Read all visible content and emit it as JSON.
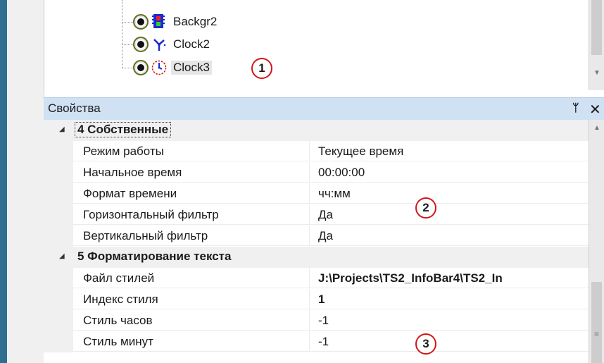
{
  "tree": {
    "nodes": [
      {
        "label": "Backgr2",
        "icon": "film-icon"
      },
      {
        "label": "Clock2",
        "icon": "clock-hands-icon"
      },
      {
        "label": "Clock3",
        "icon": "clock-dial-icon",
        "selected": true
      }
    ]
  },
  "callouts": [
    "1",
    "2",
    "3"
  ],
  "properties": {
    "title": "Свойства",
    "pin_icon": "pin-icon",
    "close_icon": "close-icon",
    "categories": [
      {
        "label": "4 Собственные",
        "rows": [
          {
            "name": "Режим работы",
            "value": "Текущее время"
          },
          {
            "name": "Начальное время",
            "value": "00:00:00"
          },
          {
            "name": "Формат времени",
            "value": "чч:мм"
          },
          {
            "name": "Горизонтальный фильтр",
            "value": "Да"
          },
          {
            "name": "Вертикальный фильтр",
            "value": "Да"
          }
        ]
      },
      {
        "label": "5 Форматирование текста",
        "rows": [
          {
            "name": "Файл стилей",
            "value": "J:\\Projects\\TS2_InfoBar4\\TS2_In",
            "bold": true
          },
          {
            "name": "Индекс стиля",
            "value": "1",
            "bold": true
          },
          {
            "name": "Стиль часов",
            "value": "-1"
          },
          {
            "name": "Стиль минут",
            "value": "-1"
          }
        ]
      }
    ]
  },
  "colors": {
    "header_bg": "#cfe1f3",
    "callout_border": "#d01818",
    "eye_ring": "#5e6e1e"
  }
}
